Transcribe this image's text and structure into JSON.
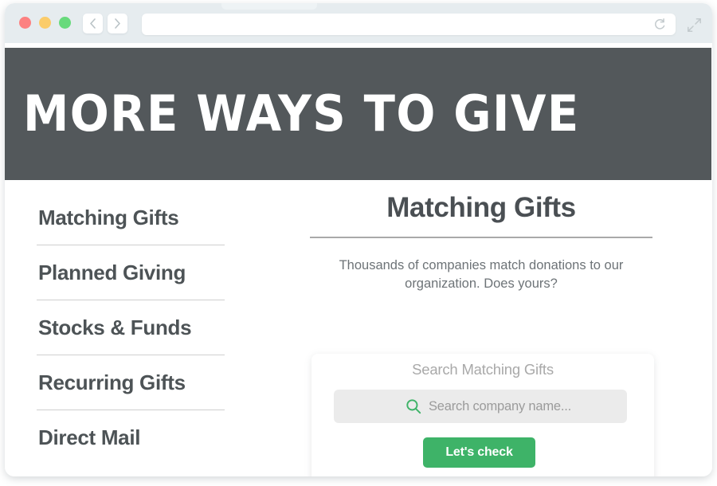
{
  "browser": {
    "traffic_lights": [
      "close-red",
      "minimize-yellow",
      "maximize-green"
    ],
    "back_label": "‹",
    "forward_label": "›",
    "address_value": "",
    "address_placeholder": "",
    "reload_icon": "reload-icon",
    "expand_icon": "expand-icon",
    "colors": {
      "chrome_bg": "#e6ecef",
      "red": "#fc8181",
      "yellow": "#fbcc6a",
      "green": "#68da7c"
    }
  },
  "hero": {
    "title": "MORE WAYS TO GIVE",
    "bg_color": "#53585b",
    "text_color": "#ffffff"
  },
  "sidebar": {
    "items": [
      {
        "label": "Matching Gifts"
      },
      {
        "label": "Planned Giving"
      },
      {
        "label": "Stocks & Funds"
      },
      {
        "label": "Recurring Gifts"
      },
      {
        "label": "Direct Mail"
      }
    ]
  },
  "main": {
    "title": "Matching Gifts",
    "description": "Thousands of companies match donations to our organization. Does yours?",
    "card": {
      "label": "Search Matching Gifts",
      "search_icon": "search-icon",
      "search_value": "",
      "search_placeholder": "Search company name...",
      "button_label": "Let's check",
      "button_color": "#3eb368"
    }
  }
}
